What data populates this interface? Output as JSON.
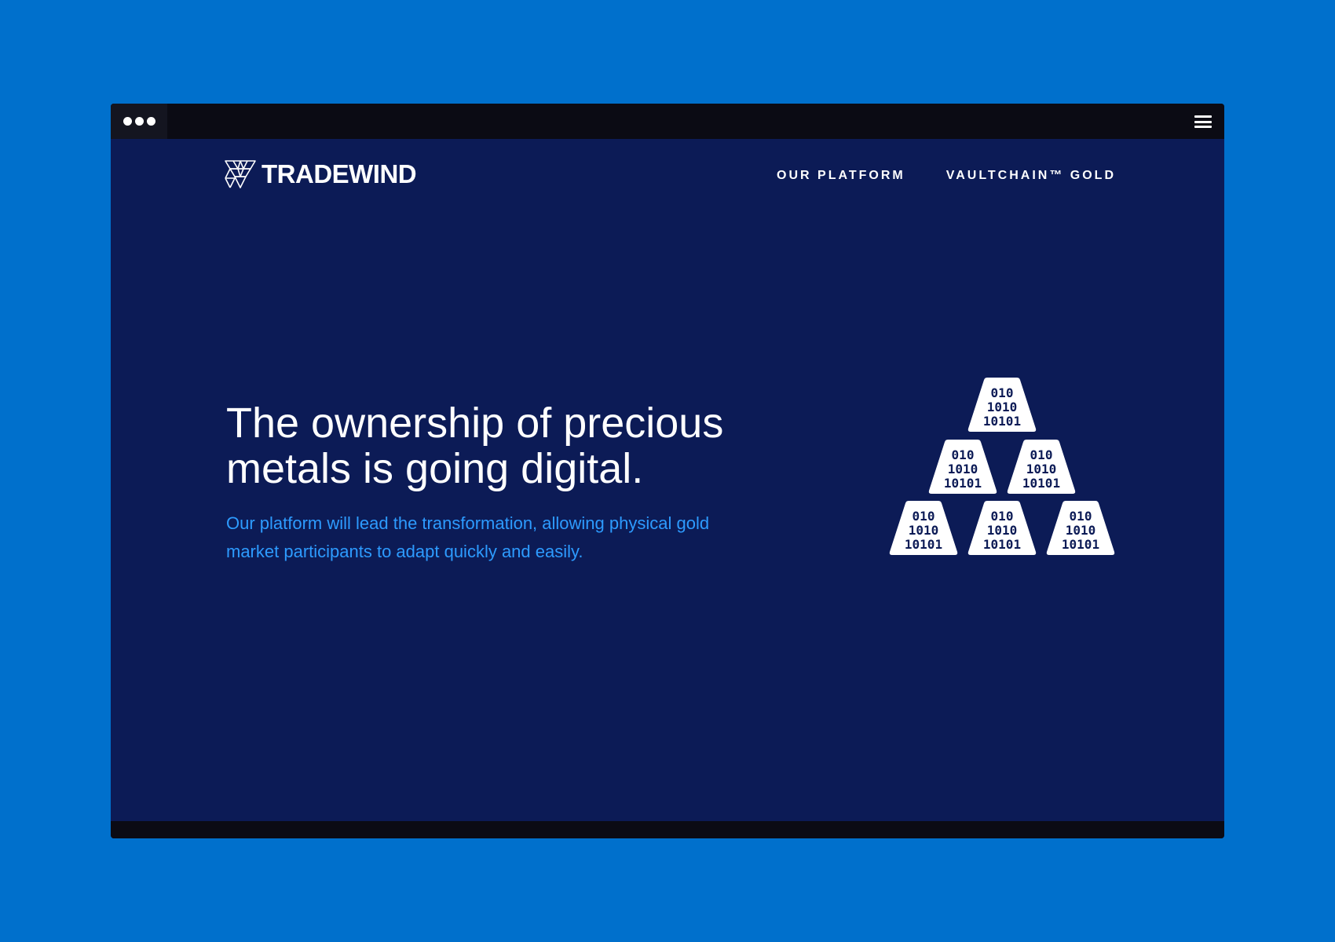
{
  "browser": {
    "controls": [
      "window-dot",
      "window-dot",
      "window-dot"
    ],
    "menu_icon": "hamburger-menu-icon"
  },
  "header": {
    "logo_text": "TRADEWIND",
    "nav": [
      {
        "label": "OUR PLATFORM"
      },
      {
        "label": "VAULTCHAIN™ GOLD"
      }
    ]
  },
  "hero": {
    "title_line1": "The ownership of precious",
    "title_line2": "metals is going digital.",
    "subtitle_line1": "Our platform will lead the transformation, allowing physical gold",
    "subtitle_line2": "market participants to adapt quickly and easily."
  },
  "illustration": {
    "bars": [
      {
        "line1": "010",
        "line2": "1010",
        "line3": "10101"
      },
      {
        "line1": "010",
        "line2": "1010",
        "line3": "10101"
      },
      {
        "line1": "010",
        "line2": "1010",
        "line3": "10101"
      },
      {
        "line1": "010",
        "line2": "1010",
        "line3": "10101"
      },
      {
        "line1": "010",
        "line2": "1010",
        "line3": "10101"
      },
      {
        "line1": "010",
        "line2": "1010",
        "line3": "10101"
      }
    ]
  },
  "colors": {
    "outer_background": "#0070cc",
    "page_background": "#0c1b56",
    "chrome": "#0b0b14",
    "accent_text": "#2d9bff",
    "text": "#ffffff"
  }
}
